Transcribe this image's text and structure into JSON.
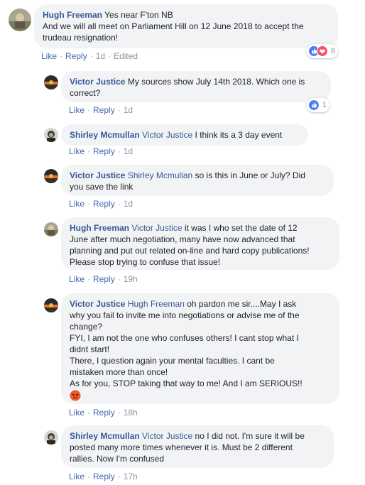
{
  "comments": [
    {
      "author": "Hugh Freeman",
      "lines": [
        "Yes near F'ton NB",
        "And we will all meet on Parliament Hill on 12 June 2018 to accept the",
        "trudeau resignation!"
      ],
      "actions": {
        "like": "Like",
        "reply": "Reply",
        "time": "1d",
        "edited": "Edited"
      },
      "reaction_count": "8"
    },
    {
      "author": "Victor Justice",
      "lines": [
        "My sources show July 14th 2018. Which one is",
        "correct?"
      ],
      "actions": {
        "like": "Like",
        "reply": "Reply",
        "time": "1d"
      },
      "reaction_count": "1"
    },
    {
      "author": "Shirley Mcmullan",
      "mention": "Victor Justice",
      "lines": [
        "I think its a 3 day event"
      ],
      "actions": {
        "like": "Like",
        "reply": "Reply",
        "time": "1d"
      }
    },
    {
      "author": "Victor Justice",
      "mention": "Shirley Mcmullan",
      "lines": [
        "so is this in June or July? Did",
        "you save the link"
      ],
      "actions": {
        "like": "Like",
        "reply": "Reply",
        "time": "1d"
      }
    },
    {
      "author": "Hugh Freeman",
      "mention": "Victor Justice",
      "lines": [
        "it was I who set the date of 12",
        "June after much negotiation, many have now advanced that",
        "planning and put out related on-line and hard copy publications!",
        "Please stop trying to confuse that issue!"
      ],
      "actions": {
        "like": "Like",
        "reply": "Reply",
        "time": "19h"
      }
    },
    {
      "author": "Victor Justice",
      "mention": "Hugh Freeman",
      "lines": [
        "oh pardon me sir....May I ask",
        "why you fail to invite me into negotiations or advise me of the",
        "change?",
        "FYI, I am not the one who confuses others! I cant stop what I",
        "didnt start!",
        "There, I question again your mental faculties. I cant be",
        "mistaken more than once!",
        "As for you, STOP taking that way to me! And I am SERIOUS!!"
      ],
      "emoji": "angry-face-emoji",
      "actions": {
        "like": "Like",
        "reply": "Reply",
        "time": "18h"
      }
    },
    {
      "author": "Shirley Mcmullan",
      "mention": "Victor Justice",
      "lines": [
        "no I did not. I'm sure it will be",
        "posted many more times whenever it is. Must be 2 different",
        "rallies. Now I'm confused"
      ],
      "actions": {
        "like": "Like",
        "reply": "Reply",
        "time": "17h"
      }
    }
  ],
  "icons": {
    "like": "like-reaction-icon",
    "love": "love-reaction-icon"
  },
  "colors": {
    "name": "#385898",
    "action": "#4267b2",
    "bubble": "#f2f3f5",
    "meta": "#90949c",
    "like": "#4a7cf7",
    "love": "#f25268"
  }
}
